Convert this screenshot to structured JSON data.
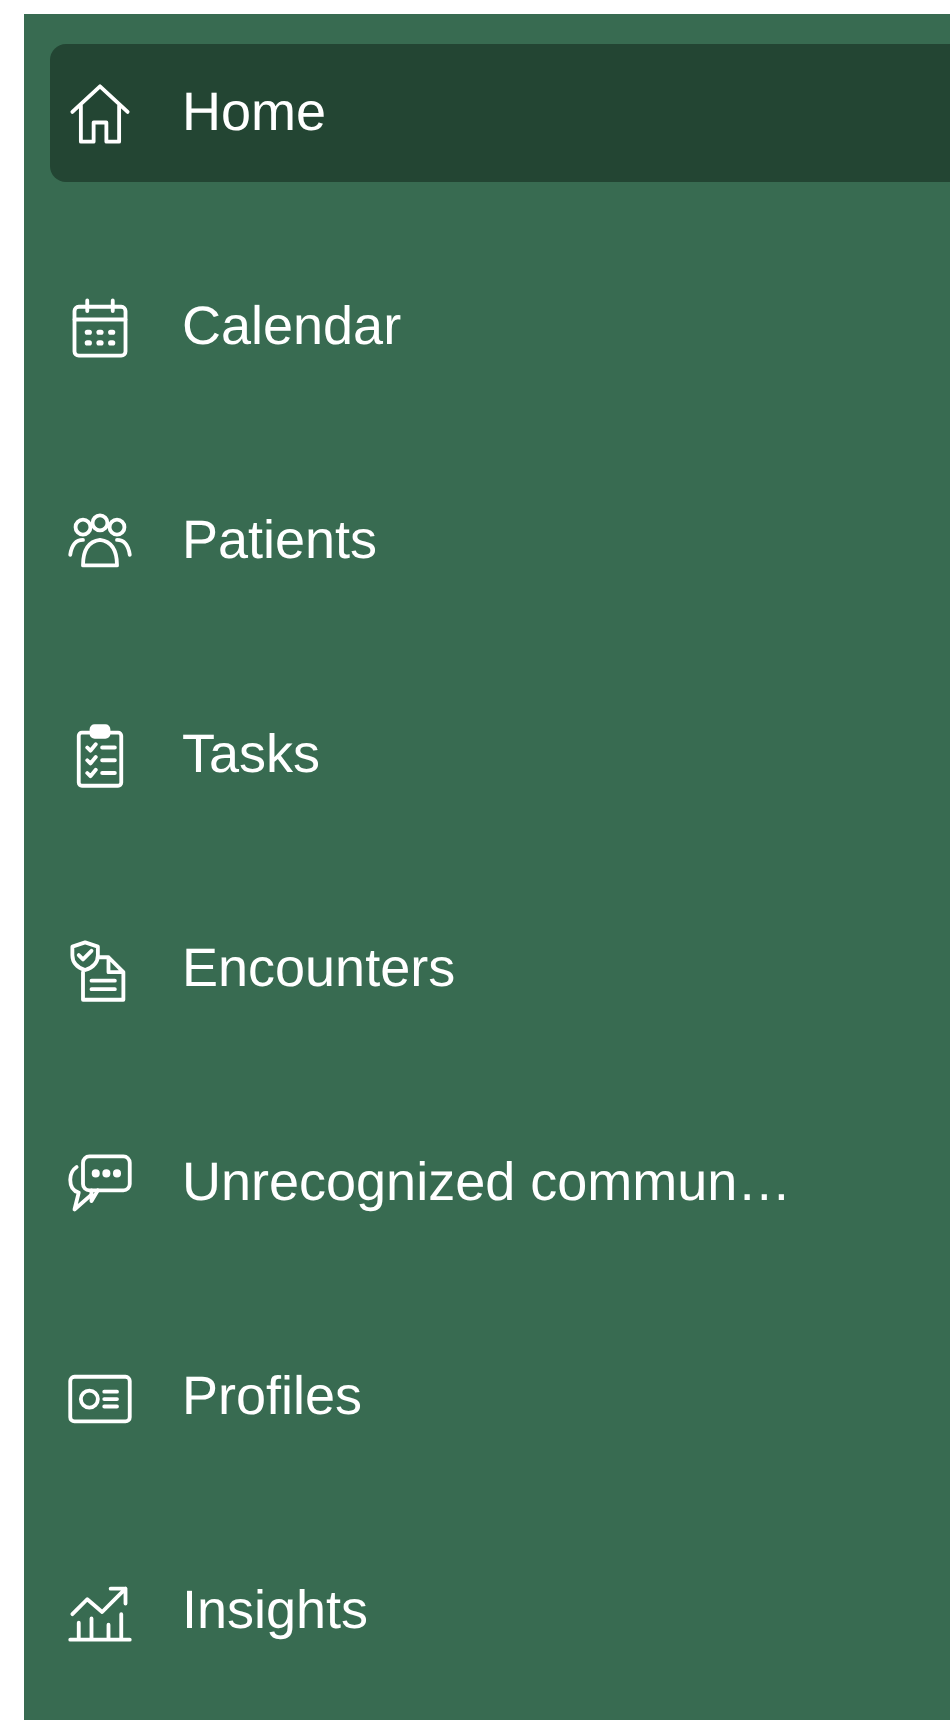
{
  "sidebar": {
    "items": [
      {
        "label": "Home",
        "selected": true
      },
      {
        "label": "Calendar",
        "selected": false
      },
      {
        "label": "Patients",
        "selected": false
      },
      {
        "label": "Tasks",
        "selected": false
      },
      {
        "label": "Encounters",
        "selected": false
      },
      {
        "label": "Unrecognized commun…",
        "selected": false
      },
      {
        "label": "Profiles",
        "selected": false
      },
      {
        "label": "Insights",
        "selected": false
      }
    ]
  }
}
